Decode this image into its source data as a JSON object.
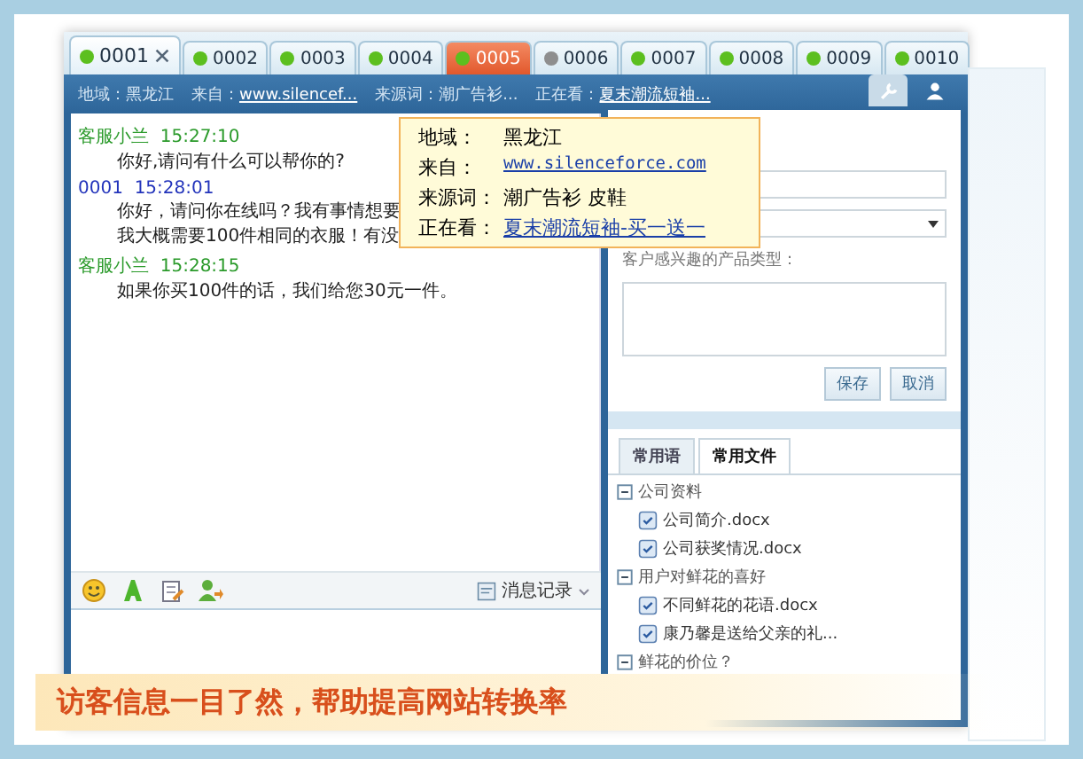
{
  "tabs": [
    {
      "label": "0001",
      "selected": true,
      "color": "#5cbf1f",
      "alert": false
    },
    {
      "label": "0002",
      "selected": false,
      "color": "#5cbf1f",
      "alert": false
    },
    {
      "label": "0003",
      "selected": false,
      "color": "#5cbf1f",
      "alert": false
    },
    {
      "label": "0004",
      "selected": false,
      "color": "#5cbf1f",
      "alert": false
    },
    {
      "label": "0005",
      "selected": false,
      "color": "#5cbf1f",
      "alert": true
    },
    {
      "label": "0006",
      "selected": false,
      "color": "#8e8e8e",
      "alert": false
    },
    {
      "label": "0007",
      "selected": false,
      "color": "#5cbf1f",
      "alert": false
    },
    {
      "label": "0008",
      "selected": false,
      "color": "#5cbf1f",
      "alert": false
    },
    {
      "label": "0009",
      "selected": false,
      "color": "#5cbf1f",
      "alert": false
    },
    {
      "label": "0010",
      "selected": false,
      "color": "#5cbf1f",
      "alert": false
    }
  ],
  "info_bar": [
    {
      "label": "地域：",
      "value": "黑龙江",
      "link": false
    },
    {
      "label": "来自：",
      "value": "www.silencef...",
      "link": true
    },
    {
      "label": "来源词：",
      "value": "潮广告衫...",
      "link": false
    },
    {
      "label": "正在看：",
      "value": "夏末潮流短袖...",
      "link": true
    }
  ],
  "messages": [
    {
      "sender": "客服小兰",
      "time": "15:27:10",
      "kind": "agent",
      "lines": [
        "你好,请问有什么可以帮你的?"
      ]
    },
    {
      "sender": "0001",
      "time": "15:28:01",
      "kind": "visitor",
      "lines": [
        "你好，请问你在线吗？我有事情想要",
        "我大概需要100件相同的衣服！有没"
      ]
    },
    {
      "sender": "客服小兰",
      "time": "15:28:15",
      "kind": "agent",
      "lines": [
        "如果你买100件的话，我们给您30元一件。"
      ]
    }
  ],
  "chat_toolbar": {
    "history": "消息记录"
  },
  "tooltip": [
    {
      "label": "地域：",
      "value": "黑龙江",
      "link": false
    },
    {
      "label": "来自：",
      "value": "www.silenceforce.com",
      "link": true
    },
    {
      "label": "来源词：",
      "value": "潮广告衫 皮鞋",
      "link": false
    },
    {
      "label": "正在看：",
      "value": "夏末潮流短袖-买一送一",
      "link": true
    }
  ],
  "form": {
    "interest_label": "客户感兴趣的产品类型：",
    "buttons": [
      "保存",
      "取消"
    ]
  },
  "panel_tabs": [
    {
      "label": "常用语",
      "selected": false
    },
    {
      "label": "常用文件",
      "selected": true
    }
  ],
  "files": [
    {
      "label": "公司资料",
      "expanded": true,
      "children": [
        {
          "label": "公司简介.docx"
        },
        {
          "label": "公司获奖情况.docx"
        }
      ]
    },
    {
      "label": "用户对鲜花的喜好",
      "expanded": true,
      "children": [
        {
          "label": "不同鲜花的花语.docx"
        },
        {
          "label": "康乃馨是送给父亲的礼..."
        }
      ]
    },
    {
      "label": "鲜花的价位？",
      "expanded": true
    }
  ],
  "banner": "访客信息一目了然，帮助提高网站转换率"
}
